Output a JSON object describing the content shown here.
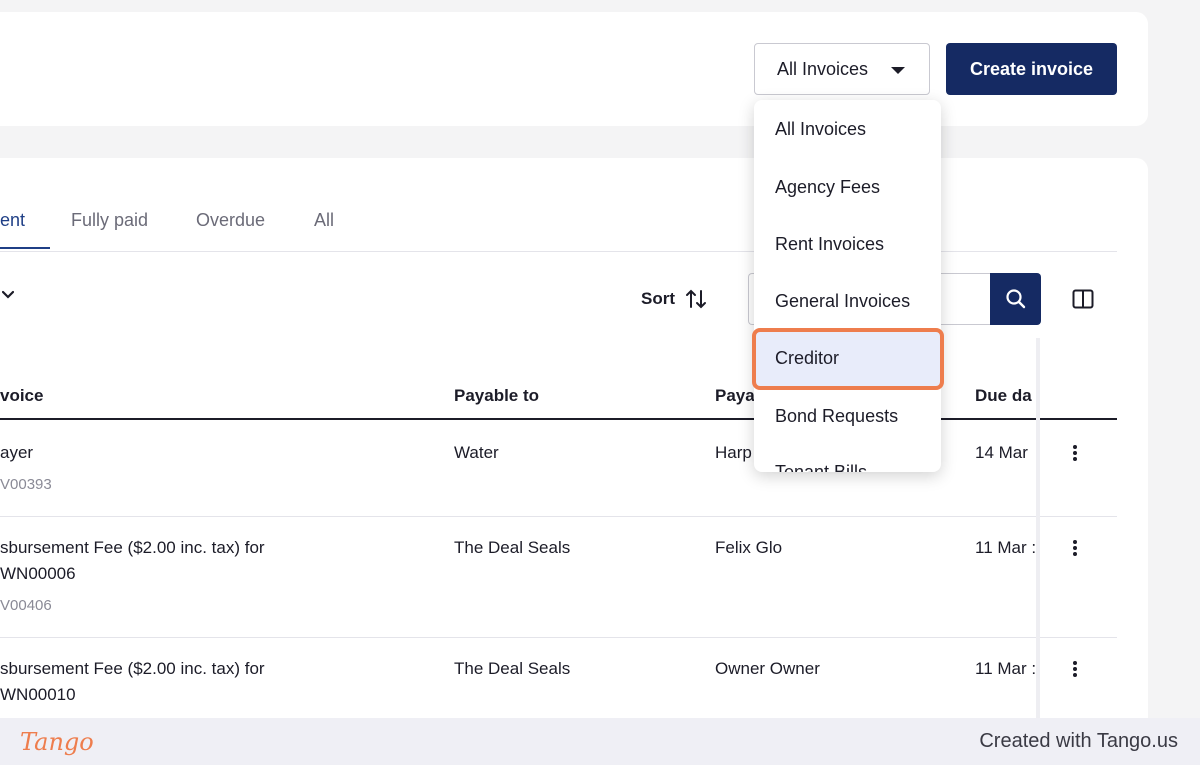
{
  "header": {
    "filter_selected": "All Invoices",
    "create_button": "Create invoice"
  },
  "tabs": [
    "ent",
    "Fully paid",
    "Overdue",
    "All"
  ],
  "toolbar": {
    "sort_label": "Sort"
  },
  "table": {
    "headers": [
      "voice",
      "Payable to",
      "Paya",
      "Due da"
    ],
    "rows": [
      {
        "invoice": "ayer",
        "invoice_line2": "",
        "ref": "V00393",
        "payable_to": "Water",
        "payer": "Harp",
        "due": "14 Mar"
      },
      {
        "invoice": "sbursement Fee ($2.00 inc. tax) for",
        "invoice_line2": "WN00006",
        "ref": "V00406",
        "payable_to": "The Deal Seals",
        "payer": "Felix Glo",
        "due": "11 Mar :"
      },
      {
        "invoice": "sbursement Fee ($2.00 inc. tax) for",
        "invoice_line2": "WN00010",
        "ref": "",
        "payable_to": "The Deal Seals",
        "payer": "Owner Owner",
        "due": "11 Mar :"
      }
    ]
  },
  "dropdown_menu": {
    "items": [
      "All Invoices",
      "Agency Fees",
      "Rent Invoices",
      "General Invoices",
      "Creditor",
      "Bond Requests",
      "Tenant Bills"
    ],
    "highlighted": "Creditor"
  },
  "footer": {
    "logo": "Tango",
    "credit": "Created with Tango.us"
  },
  "colors": {
    "primary": "#152a63",
    "highlight_border": "#ee7d4d",
    "tab_active": "#1f3f86"
  }
}
